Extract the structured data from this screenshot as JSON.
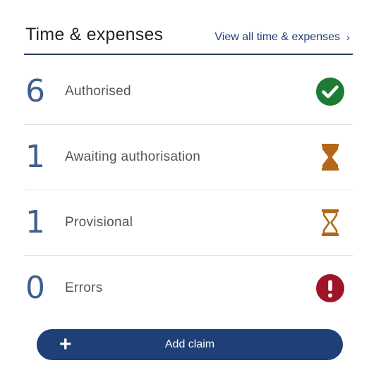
{
  "header": {
    "title": "Time & expenses",
    "link_label": "View all time & expenses",
    "link_chevron": "›"
  },
  "rows": [
    {
      "count": "6",
      "label": "Authorised",
      "icon": "check-circle-icon",
      "color": "#1e7a34"
    },
    {
      "count": "1",
      "label": "Awaiting authorisation",
      "icon": "hourglass-filled-icon",
      "color": "#b5671a"
    },
    {
      "count": "1",
      "label": "Provisional",
      "icon": "hourglass-outline-icon",
      "color": "#b5671a"
    },
    {
      "count": "0",
      "label": "Errors",
      "icon": "exclamation-circle-icon",
      "color": "#a0142a"
    }
  ],
  "add_button": {
    "label": "Add claim",
    "icon": "plus-icon",
    "plus_glyph": "+",
    "color": "#1f3f77"
  }
}
